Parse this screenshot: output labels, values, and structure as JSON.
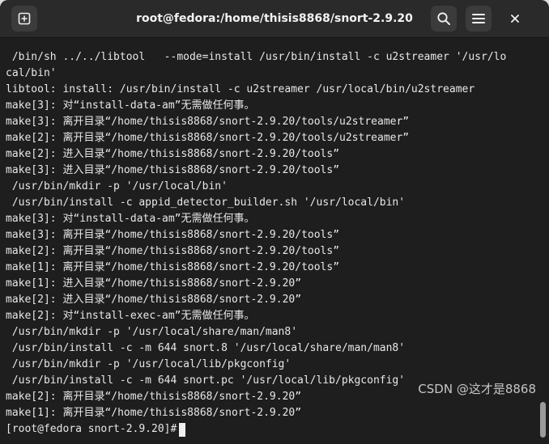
{
  "window": {
    "title": "root@fedora:/home/thisis8868/snort-2.9.20"
  },
  "terminal": {
    "lines": [
      " /bin/sh ../../libtool   --mode=install /usr/bin/install -c u2streamer '/usr/lo",
      "cal/bin'",
      "libtool: install: /usr/bin/install -c u2streamer /usr/local/bin/u2streamer",
      "make[3]: 对“install-data-am”无需做任何事。",
      "make[3]: 离开目录“/home/thisis8868/snort-2.9.20/tools/u2streamer”",
      "make[2]: 离开目录“/home/thisis8868/snort-2.9.20/tools/u2streamer”",
      "make[2]: 进入目录“/home/thisis8868/snort-2.9.20/tools”",
      "make[3]: 进入目录“/home/thisis8868/snort-2.9.20/tools”",
      " /usr/bin/mkdir -p '/usr/local/bin'",
      " /usr/bin/install -c appid_detector_builder.sh '/usr/local/bin'",
      "make[3]: 对“install-data-am”无需做任何事。",
      "make[3]: 离开目录“/home/thisis8868/snort-2.9.20/tools”",
      "make[2]: 离开目录“/home/thisis8868/snort-2.9.20/tools”",
      "make[1]: 离开目录“/home/thisis8868/snort-2.9.20/tools”",
      "make[1]: 进入目录“/home/thisis8868/snort-2.9.20”",
      "make[2]: 进入目录“/home/thisis8868/snort-2.9.20”",
      "make[2]: 对“install-exec-am”无需做任何事。",
      " /usr/bin/mkdir -p '/usr/local/share/man/man8'",
      " /usr/bin/install -c -m 644 snort.8 '/usr/local/share/man/man8'",
      " /usr/bin/mkdir -p '/usr/local/lib/pkgconfig'",
      " /usr/bin/install -c -m 644 snort.pc '/usr/local/lib/pkgconfig'",
      "make[2]: 离开目录“/home/thisis8868/snort-2.9.20”",
      "make[1]: 离开目录“/home/thisis8868/snort-2.9.20”"
    ],
    "prompt": "[root@fedora snort-2.9.20]#"
  },
  "watermark": "CSDN @这才是8868",
  "icons": {
    "new_tab": "new-tab-icon",
    "search": "search-icon",
    "menu": "hamburger-menu-icon",
    "close": "close-icon"
  },
  "colors": {
    "terminal_bg": "#1e1e1e",
    "titlebar_bg": "#2a2a2a",
    "text": "#e8e8e8"
  }
}
